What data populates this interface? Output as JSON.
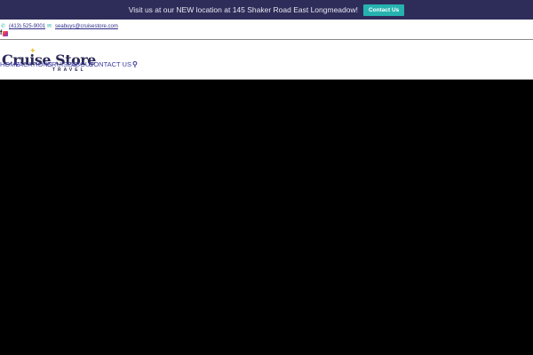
{
  "banner": {
    "text": "Visit us at our NEW location at 145 Shaker Road East Longmeadow!",
    "button": "Contact Us"
  },
  "topbar": {
    "phone": "(413) 525-9001",
    "email": "seabuys@cruisestore.com",
    "social": [
      "facebook",
      "instagram"
    ]
  },
  "logo": {
    "name": "Cruise Store",
    "sub": "TRAVEL"
  },
  "nav": {
    "items": [
      "HOME",
      "VACATIONS",
      "CRUISES",
      "ABOUT",
      "CONTACT US"
    ]
  }
}
